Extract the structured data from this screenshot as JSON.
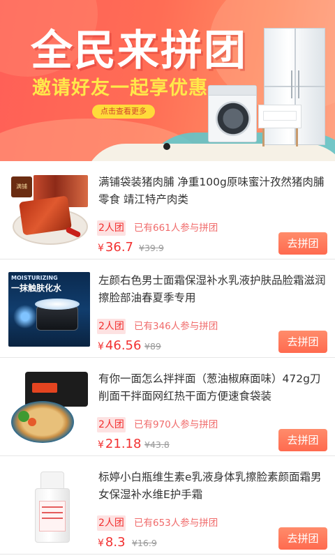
{
  "banner": {
    "title": "全民来拼团",
    "subtitle": "邀请好友一起享优惠",
    "button_label": "点击查看更多",
    "page_indicator": 1
  },
  "products": [
    {
      "title": "满铺袋装猪肉脯 净重100g原味蜜汁孜然猪肉脯零食 靖江特产肉类",
      "group_size": "2人团",
      "joined_text": "已有661人参与拼团",
      "currency": "¥",
      "price": "36.7",
      "original_price": "¥39.9",
      "button_label": "去拼团",
      "image_icon": "pork-jerky-image"
    },
    {
      "title": "左颜右色男士面霜保湿补水乳液护肤品脸霜滋润擦脸部油春夏季专用",
      "group_size": "2人团",
      "joined_text": "已有346人参与拼团",
      "currency": "¥",
      "price": "46.56",
      "original_price": "¥89",
      "button_label": "去拼团",
      "image_icon": "face-cream-image",
      "image_text": {
        "brand": "MOISTURIZING",
        "slogan": "一抹触肤化水"
      }
    },
    {
      "title": "有你一面怎么拌拌面（葱油椒麻面味）472g刀削面干拌面网红热干面方便速食袋装",
      "group_size": "2人团",
      "joined_text": "已有970人参与拼团",
      "currency": "¥",
      "price": "21.18",
      "original_price": "¥43.8",
      "button_label": "去拼团",
      "image_icon": "noodle-bowl-image"
    },
    {
      "title": "标婷小白瓶维生素e乳液身体乳擦脸素颜面霜男女保湿补水维E护手霜",
      "group_size": "2人团",
      "joined_text": "已有653人参与拼团",
      "currency": "¥",
      "price": "8.3",
      "original_price": "¥16.9",
      "button_label": "去拼团",
      "image_icon": "lotion-bottle-image"
    }
  ],
  "colors": {
    "accent_red": "#f23030",
    "button_orange": "#ff6a4f",
    "banner_yellow": "#ffe84a"
  }
}
